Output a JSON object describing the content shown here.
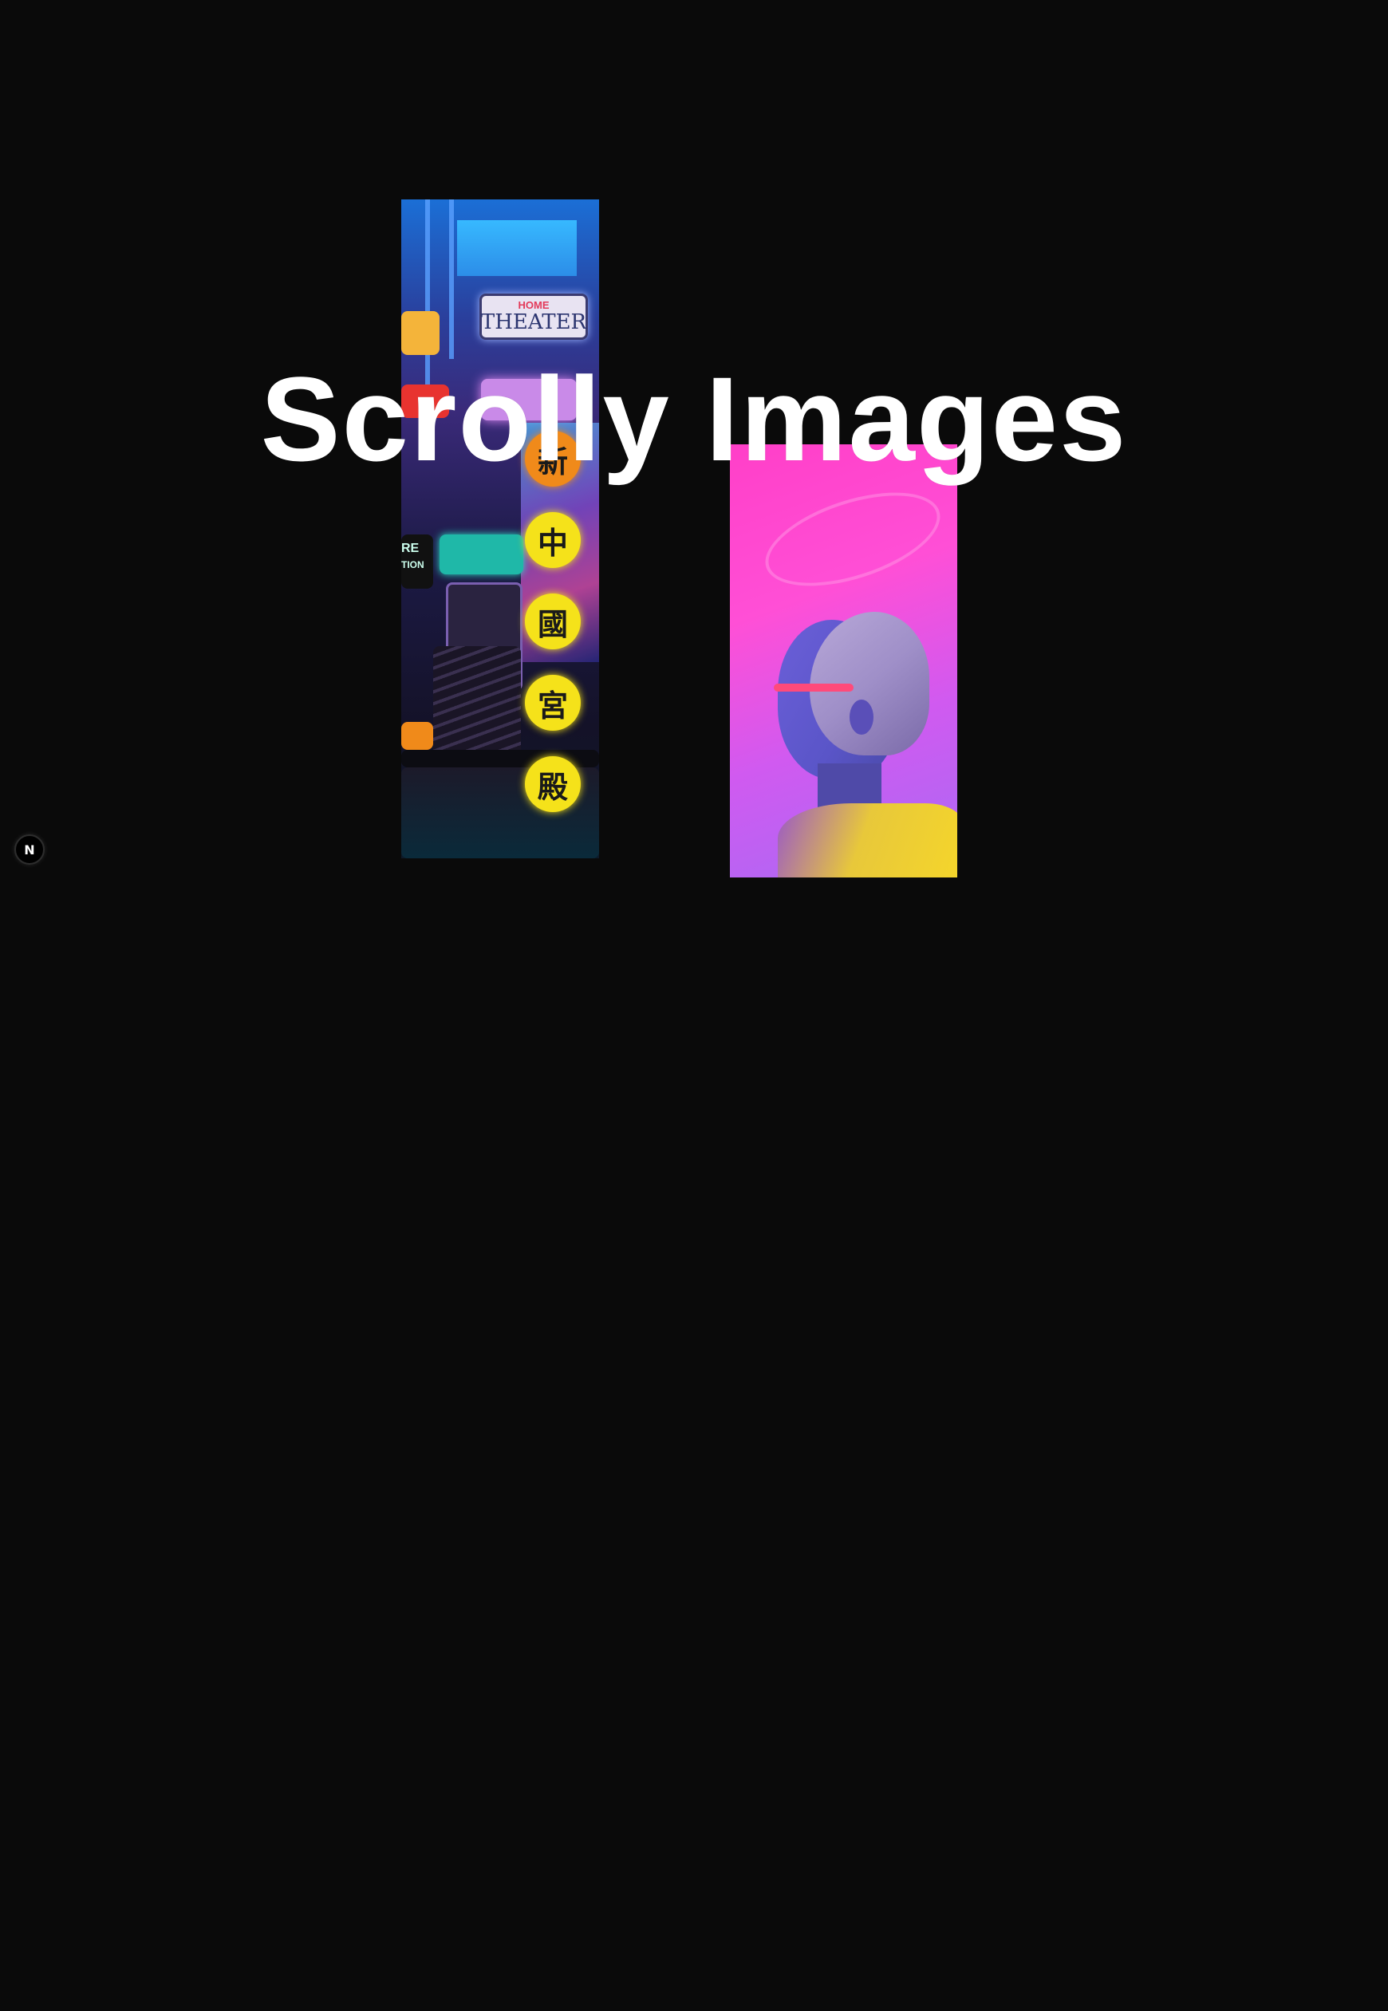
{
  "page": {
    "title": "Scrolly Images",
    "background_color": "#0a0a0a",
    "title_color": "#ffffff"
  },
  "images": {
    "left": {
      "description_icon": "neon-street-image",
      "signs": {
        "home": "HOME",
        "theater": "THEATER",
        "re": "RE",
        "tion": "TION"
      },
      "characters": [
        "新",
        "中",
        "國",
        "宮",
        "殿"
      ]
    },
    "right": {
      "description_icon": "portrait-image"
    }
  },
  "badge": {
    "label": "N",
    "icon": "framework-logo-icon"
  }
}
